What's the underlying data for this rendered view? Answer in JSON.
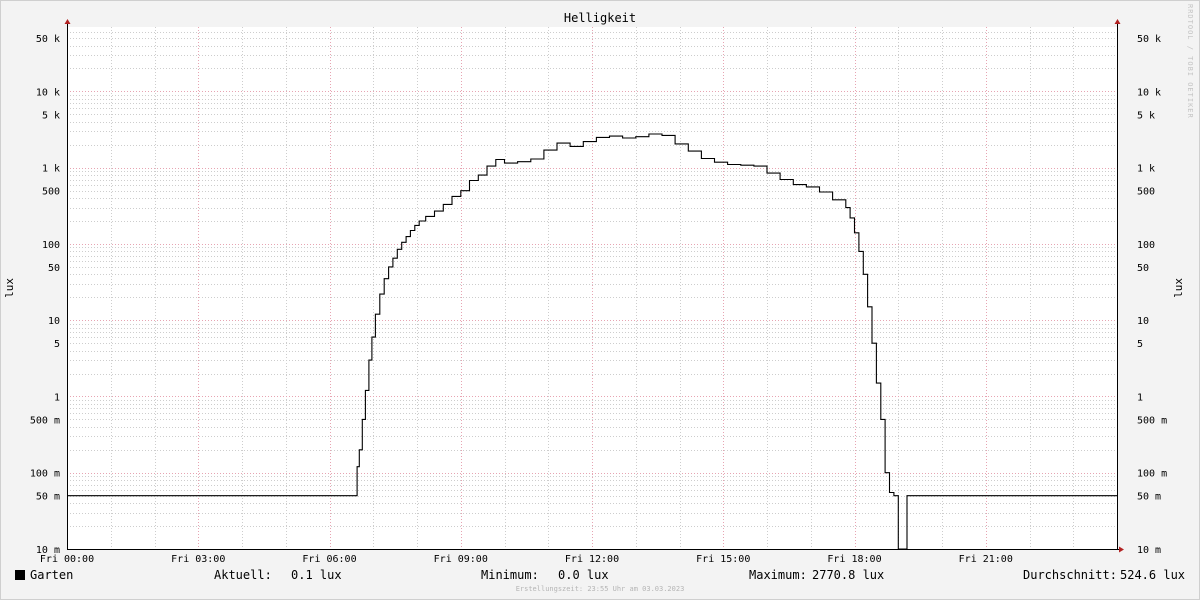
{
  "title": "Helligkeit",
  "watermark": "RRDTOOL / TOBI OETIKER",
  "ylabel_left": "lux",
  "ylabel_right": "lux",
  "legend": {
    "series_name": "Garten",
    "current_label": "Aktuell:",
    "current_value": "0.1 lux",
    "min_label": "Minimum:",
    "min_value": "0.0 lux",
    "max_label": "Maximum:",
    "max_value": "2770.8 lux",
    "avg_label": "Durchschnitt:",
    "avg_value": "524.6 lux"
  },
  "footer": "Erstellungszeit: 23:55 Uhr am 03.03.2023",
  "colors": {
    "background": "#f3f3f3",
    "plot_background": "#ffffff",
    "major_grid": "#e7a4b2",
    "minor_grid": "#cdcdcd",
    "line": "#000000",
    "axis_arrow": "#b22222"
  },
  "chart_data": {
    "type": "line",
    "scale": "log",
    "title": "Helligkeit",
    "ylabel": "lux",
    "x_unit": "hours since Fri 00:00",
    "xlim": [
      0,
      24
    ],
    "ylim": [
      0.01,
      70000
    ],
    "x_ticks": [
      {
        "value": 0,
        "label": "Fri 00:00"
      },
      {
        "value": 3,
        "label": "Fri 03:00"
      },
      {
        "value": 6,
        "label": "Fri 06:00"
      },
      {
        "value": 9,
        "label": "Fri 09:00"
      },
      {
        "value": 12,
        "label": "Fri 12:00"
      },
      {
        "value": 15,
        "label": "Fri 15:00"
      },
      {
        "value": 18,
        "label": "Fri 18:00"
      },
      {
        "value": 21,
        "label": "Fri 21:00"
      }
    ],
    "y_ticks": [
      {
        "value": 0.01,
        "label": "10 m"
      },
      {
        "value": 0.05,
        "label": "50 m"
      },
      {
        "value": 0.1,
        "label": "100 m"
      },
      {
        "value": 0.5,
        "label": "500 m"
      },
      {
        "value": 1,
        "label": "1"
      },
      {
        "value": 5,
        "label": "5"
      },
      {
        "value": 10,
        "label": "10"
      },
      {
        "value": 50,
        "label": "50"
      },
      {
        "value": 100,
        "label": "100"
      },
      {
        "value": 500,
        "label": "500"
      },
      {
        "value": 1000,
        "label": "1 k"
      },
      {
        "value": 5000,
        "label": "5 k"
      },
      {
        "value": 10000,
        "label": "10 k"
      },
      {
        "value": 50000,
        "label": "50 k"
      }
    ],
    "grid": true,
    "legend_position": "bottom",
    "series": [
      {
        "name": "Garten",
        "color": "#000000",
        "x": [
          0.0,
          6.6,
          6.63,
          6.68,
          6.75,
          6.82,
          6.9,
          6.97,
          7.05,
          7.15,
          7.25,
          7.35,
          7.45,
          7.55,
          7.65,
          7.75,
          7.85,
          7.95,
          8.05,
          8.2,
          8.4,
          8.6,
          8.8,
          9.0,
          9.2,
          9.4,
          9.6,
          9.8,
          10.0,
          10.3,
          10.6,
          10.9,
          11.2,
          11.5,
          11.8,
          12.1,
          12.4,
          12.7,
          13.0,
          13.3,
          13.6,
          13.9,
          14.2,
          14.5,
          14.8,
          15.1,
          15.4,
          15.7,
          16.0,
          16.3,
          16.6,
          16.9,
          17.2,
          17.5,
          17.8,
          17.9,
          18.0,
          18.1,
          18.2,
          18.3,
          18.4,
          18.5,
          18.6,
          18.7,
          18.8,
          18.9,
          19.0,
          19.1,
          19.17,
          19.2,
          19.25,
          19.3,
          24.0
        ],
        "y": [
          0.05,
          0.05,
          0.12,
          0.2,
          0.5,
          1.2,
          3.0,
          6.0,
          12.0,
          22.0,
          35.0,
          50.0,
          65.0,
          85.0,
          105.0,
          125.0,
          150.0,
          175.0,
          200.0,
          230.0,
          270.0,
          330.0,
          420.0,
          500.0,
          680.0,
          800.0,
          1050.0,
          1280.0,
          1150.0,
          1200.0,
          1300.0,
          1700.0,
          2100.0,
          1900.0,
          2200.0,
          2500.0,
          2600.0,
          2450.0,
          2550.0,
          2770.0,
          2650.0,
          2050.0,
          1650.0,
          1320.0,
          1180.0,
          1100.0,
          1080.0,
          1050.0,
          850.0,
          700.0,
          600.0,
          560.0,
          480.0,
          380.0,
          300.0,
          220.0,
          140.0,
          80.0,
          40.0,
          15.0,
          5.0,
          1.5,
          0.5,
          0.1,
          0.055,
          0.05,
          0.01,
          0.01,
          0.01,
          0.05,
          0.05,
          0.05,
          0.05
        ]
      }
    ]
  }
}
